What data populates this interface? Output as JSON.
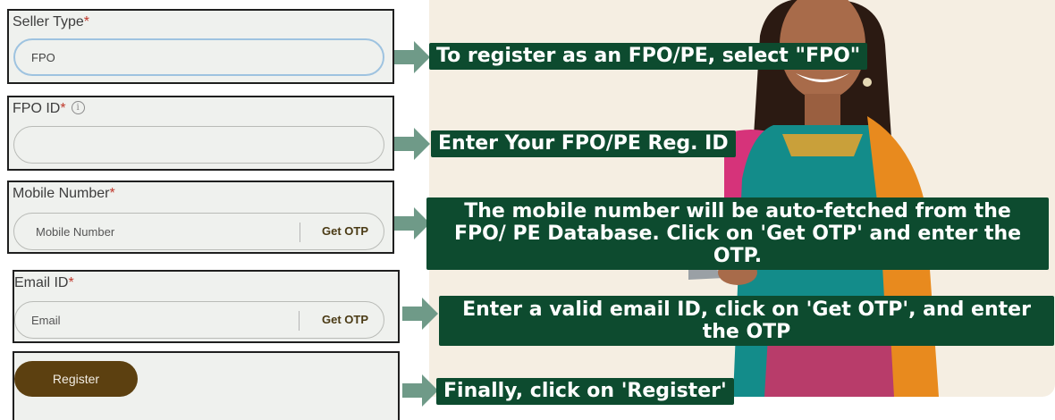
{
  "form": {
    "seller_type": {
      "label": "Seller Type",
      "required_mark": "*",
      "value": "FPO"
    },
    "fpo_id": {
      "label": "FPO ID",
      "required_mark": "*",
      "info_glyph": "i",
      "value": ""
    },
    "mobile": {
      "label": "Mobile Number",
      "required_mark": "*",
      "placeholder": "Mobile Number",
      "otp_label": "Get OTP"
    },
    "email": {
      "label": "Email ID",
      "required_mark": "*",
      "placeholder": "Email",
      "otp_label": "Get OTP"
    },
    "register_label": "Register"
  },
  "callouts": {
    "seller_type": "To register as an FPO/PE, select \"FPO\"",
    "fpo_id": "Enter Your FPO/PE Reg. ID",
    "mobile": [
      "The mobile number will be auto-fetched from the",
      "FPO/ PE Database. Click on 'Get OTP' and enter the",
      "OTP."
    ],
    "email": [
      "Enter a valid email ID, click on 'Get OTP', and enter",
      "the OTP"
    ],
    "register": "Finally, click on 'Register'"
  },
  "colors": {
    "callout_bg": "#0d4b2f",
    "arrow": "#6f9a88",
    "register_bg": "#5c4010",
    "panel_bg": "#f5eee2",
    "required": "#c0392b"
  }
}
